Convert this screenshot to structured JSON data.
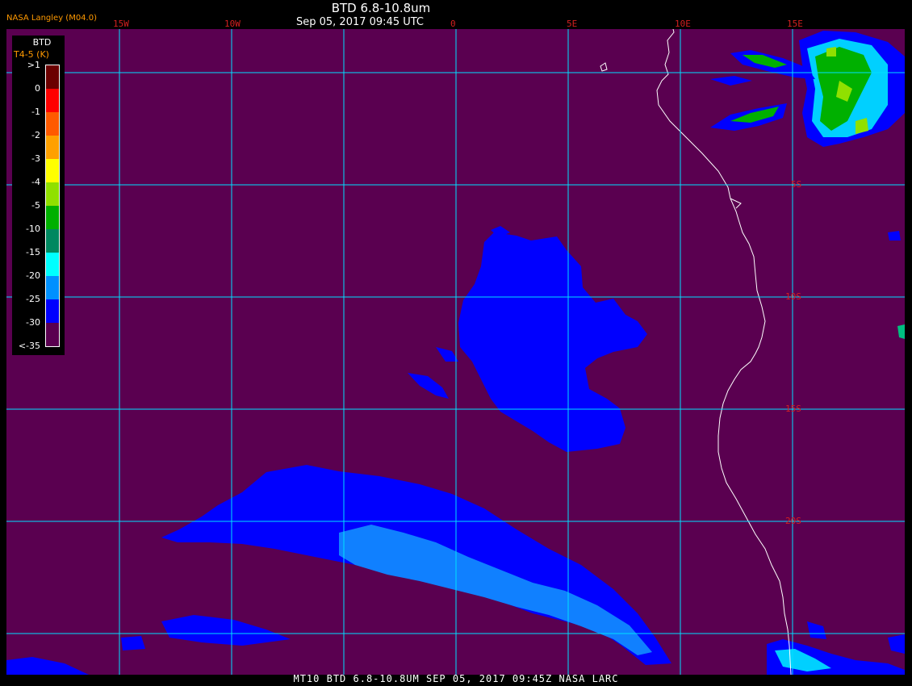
{
  "header": {
    "producer": "NASA Langley (M04.0)",
    "title": "BTD 6.8-10.8um",
    "timestamp": "Sep 05, 2017 09:45 UTC"
  },
  "footer": "MT10  BTD 6.8-10.8UM  SEP 05, 2017 09:45Z  NASA LARC",
  "legend": {
    "title": "BTD",
    "units": "T4-5 (K)",
    "items": [
      {
        "label": ">1",
        "color": "#6b0000"
      },
      {
        "label": "0",
        "color": "#ff0000"
      },
      {
        "label": "-1",
        "color": "#ff5a00"
      },
      {
        "label": "-2",
        "color": "#ffa000"
      },
      {
        "label": "-3",
        "color": "#ffff00"
      },
      {
        "label": "-4",
        "color": "#90e000"
      },
      {
        "label": "-5",
        "color": "#00b000"
      },
      {
        "label": "-10",
        "color": "#008860"
      },
      {
        "label": "-15",
        "color": "#00ffff"
      },
      {
        "label": "-20",
        "color": "#0090ff"
      },
      {
        "label": "-25",
        "color": "#0000ff"
      },
      {
        "label": "-30",
        "color": "#5a0050"
      },
      {
        "label": "<-35",
        "color": "#5a0050"
      }
    ]
  },
  "grid": {
    "lon_labels": [
      "15W",
      "10W",
      "0",
      "5E",
      "10E",
      "15E"
    ],
    "lat_labels": [
      "5S",
      "10S",
      "15S",
      "20S"
    ]
  },
  "colors": {
    "background": "#5a0050",
    "grid": "#00e0ff",
    "coast": "#ffffff",
    "grid_label": "#d42020"
  }
}
